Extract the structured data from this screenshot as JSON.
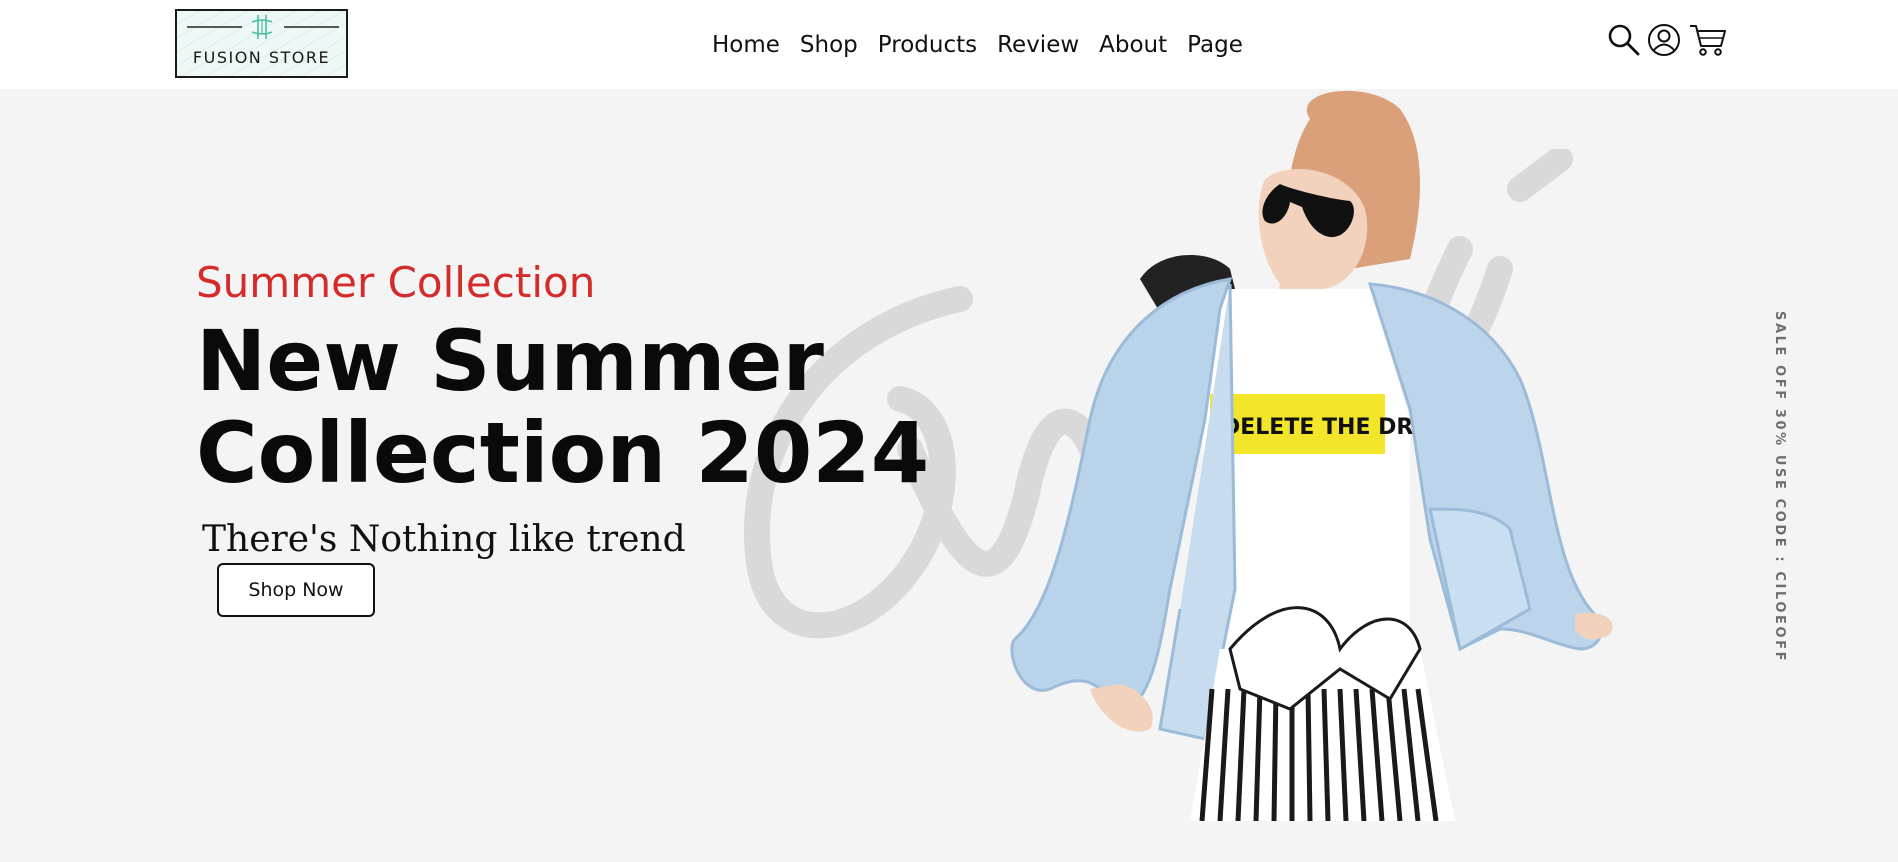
{
  "brand": {
    "name": "FUSION STORE",
    "logo_icon": "fusion-store-mark",
    "logo_accent_color": "#4bbf9c"
  },
  "nav": {
    "items": [
      {
        "label": "Home"
      },
      {
        "label": "Shop"
      },
      {
        "label": "Products"
      },
      {
        "label": "Review"
      },
      {
        "label": "About"
      },
      {
        "label": "Page"
      }
    ]
  },
  "header_icons": [
    "search-icon",
    "user-icon",
    "cart-icon"
  ],
  "hero": {
    "eyebrow": "Summer Collection",
    "headline_line1": "New Summer",
    "headline_line2": "Collection 2024",
    "subheadline": "There's Nothing like trend",
    "cta_label": "Shop Now",
    "side_promo": "SALE OFF 30% USE CODE : CILOEOFF",
    "background_color": "#f4f4f4",
    "accent_color": "#d42b2b",
    "image_tshirt_text": "DELETE THE DRAMA",
    "watermark_icon": "script-watermark"
  }
}
